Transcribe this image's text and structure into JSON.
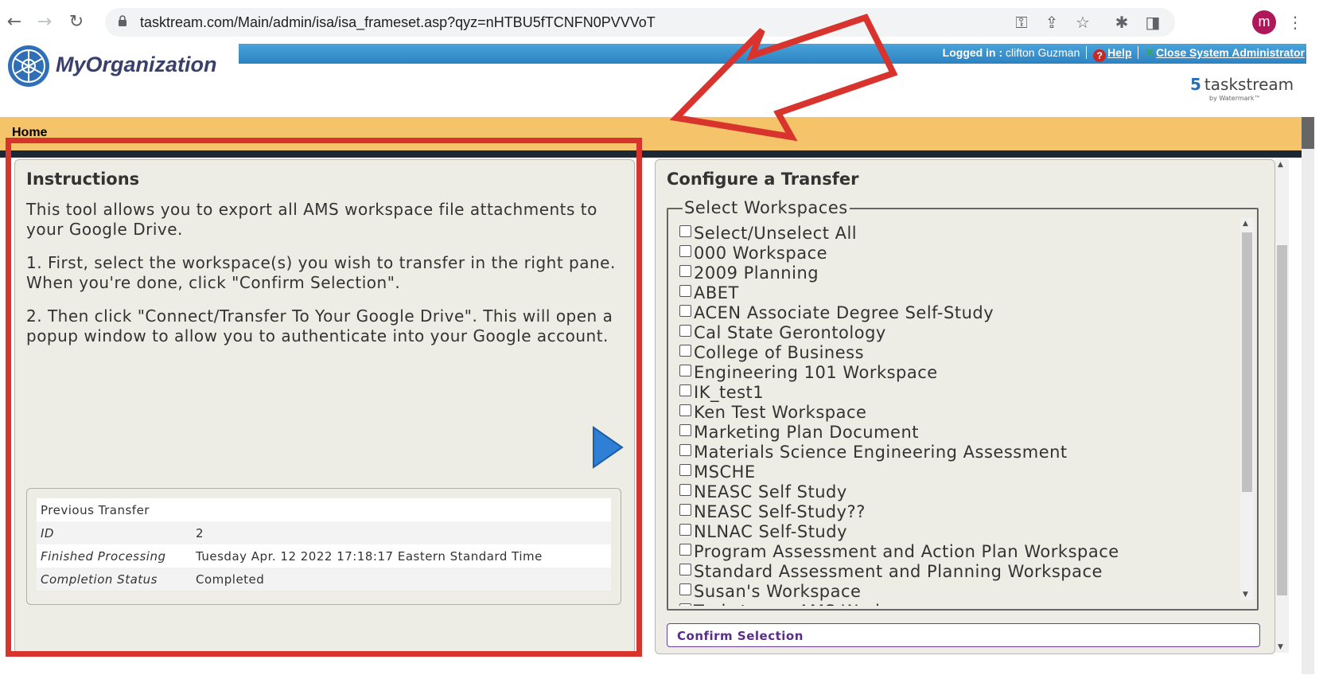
{
  "browser": {
    "url": "tasktream.com/Main/admin/isa/isa_frameset.asp?qyz=nHTBU5fTCNFN0PVVVoT",
    "avatar_letter": "m"
  },
  "header": {
    "org_name": "MyOrganization",
    "logged_in_label": "Logged in :",
    "user_name": "clifton Guzman",
    "help_link": "Help",
    "close_admin_link": "Close System Administrator",
    "brand": "taskstream",
    "brand_sub": "by Watermark™"
  },
  "nav": {
    "home_link": "Home"
  },
  "instructions": {
    "title": "Instructions",
    "para1": "This tool allows you to export all AMS workspace file attachments to your Google Drive.",
    "para2": "1. First, select the workspace(s) you wish to transfer in the right pane. When you're done, click \"Confirm Selection\".",
    "para3": "2. Then click \"Connect/Transfer To Your Google Drive\". This will open a popup window to allow you to authenticate into your Google account."
  },
  "previous_transfer": {
    "heading": "Previous Transfer",
    "rows": [
      {
        "label": "ID",
        "value": "2"
      },
      {
        "label": "Finished Processing",
        "value": "Tuesday Apr. 12 2022 17:18:17 Eastern Standard Time"
      },
      {
        "label": "Completion Status",
        "value": "Completed"
      }
    ]
  },
  "configure": {
    "title": "Configure a Transfer",
    "legend": "Select Workspaces",
    "workspaces": [
      "Select/Unselect All",
      "000 Workspace",
      "2009 Planning",
      "ABET",
      "ACEN Associate Degree Self-Study",
      "Cal State Gerontology",
      "College of Business",
      "Engineering 101 Workspace",
      "IK_test1",
      "Ken Test Workspace",
      "Marketing Plan Document",
      "Materials Science Engineering Assessment",
      "MSCHE",
      "NEASC Self Study",
      "NEASC Self-Study??",
      "NLNAC Self-Study",
      "Program Assessment and Action Plan Workspace",
      "Standard Assessment and Planning Workspace",
      "Susan's Workspace",
      "Taskstream AMS Workspace"
    ],
    "confirm_button": "Confirm Selection"
  },
  "colors": {
    "annotation_red": "#d9332e",
    "home_bar": "#f5c46a",
    "header_blue": "#2d83c3"
  }
}
